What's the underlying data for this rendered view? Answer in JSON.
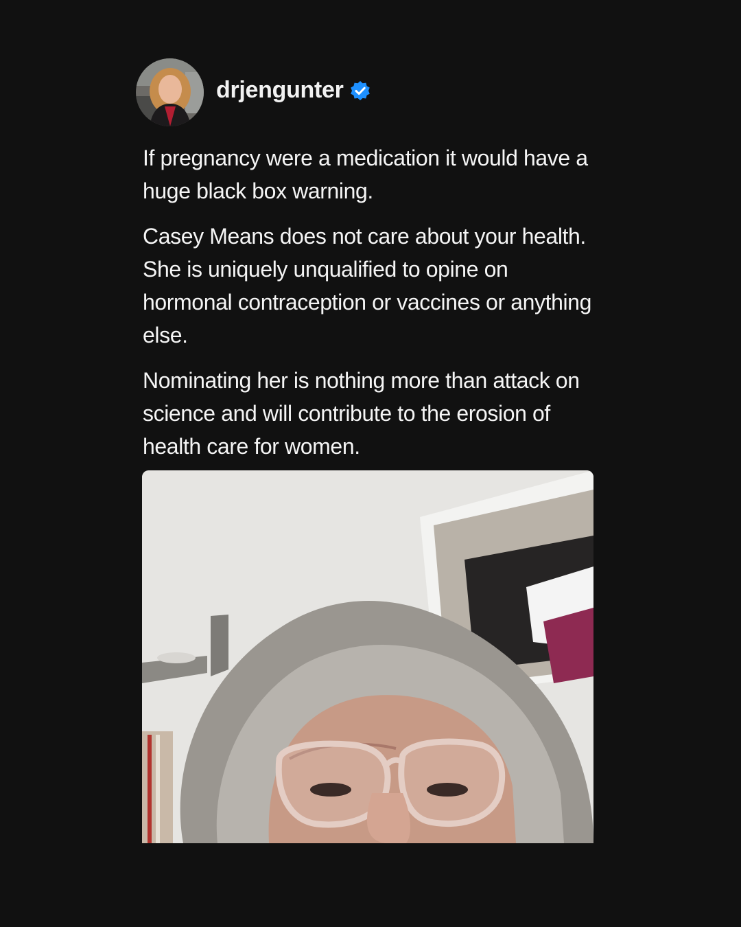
{
  "post": {
    "username": "drjengunter",
    "verified": true,
    "avatar_icon": "profile-photo",
    "paragraphs": [
      "If pregnancy were a medication it would have a huge black box warning.",
      "Casey Means does not care about your health. She is uniquely unqualified to opine on hormonal contraception or vaccines or anything else.",
      "Nominating her is nothing more than attack on science and will contribute to the erosion of health care for women."
    ],
    "media_icon": "video-thumbnail",
    "colors": {
      "background": "#111111",
      "text": "#f5f5f5",
      "verified_badge": "#1e90ff"
    }
  }
}
